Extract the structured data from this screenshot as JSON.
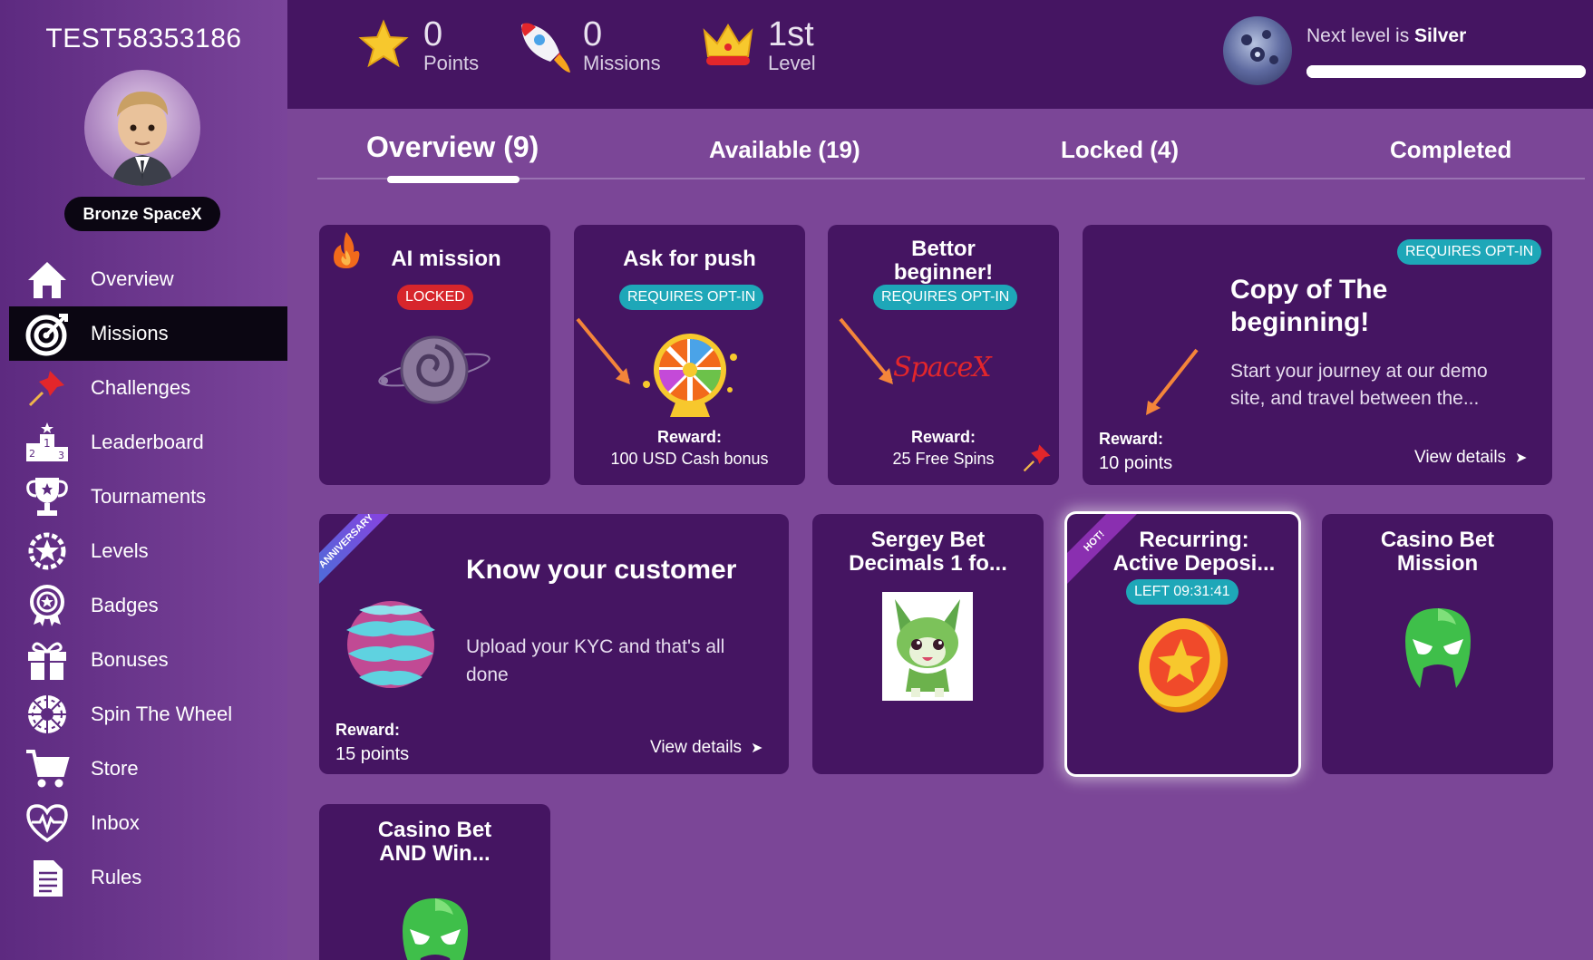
{
  "sidebar": {
    "username": "TEST58353186",
    "rank": "Bronze SpaceX",
    "items": [
      {
        "label": "Overview",
        "icon": "home-icon"
      },
      {
        "label": "Missions",
        "icon": "target-icon",
        "active": true
      },
      {
        "label": "Challenges",
        "icon": "pin-icon"
      },
      {
        "label": "Leaderboard",
        "icon": "podium-icon"
      },
      {
        "label": "Tournaments",
        "icon": "trophy-icon"
      },
      {
        "label": "Levels",
        "icon": "star-gear-icon"
      },
      {
        "label": "Badges",
        "icon": "badge-icon"
      },
      {
        "label": "Bonuses",
        "icon": "gift-icon"
      },
      {
        "label": "Spin The Wheel",
        "icon": "wheel-icon"
      },
      {
        "label": "Store",
        "icon": "cart-icon"
      },
      {
        "label": "Inbox",
        "icon": "heart-pulse-icon"
      },
      {
        "label": "Rules",
        "icon": "document-icon"
      }
    ]
  },
  "topbar": {
    "points": {
      "value": "0",
      "label": "Points"
    },
    "missions": {
      "value": "0",
      "label": "Missions"
    },
    "level": {
      "value": "1st",
      "label": "Level"
    },
    "next_level_prefix": "Next level is",
    "next_level_name": "Silver",
    "progress": 1.0
  },
  "tabs": [
    {
      "label": "Overview (9)",
      "active": true
    },
    {
      "label": "Available (19)"
    },
    {
      "label": "Locked (4)"
    },
    {
      "label": "Completed"
    }
  ],
  "cards": {
    "ai_mission": {
      "title": "AI mission",
      "status": "LOCKED"
    },
    "ask_push": {
      "title": "Ask for push",
      "status": "REQUIRES OPT-IN",
      "reward_label": "Reward:",
      "reward": "100 USD Cash bonus"
    },
    "bettor": {
      "title_line1": "Bettor",
      "title_line2": "beginner!",
      "status": "REQUIRES OPT-IN",
      "brand": "SpaceX",
      "reward_label": "Reward:",
      "reward": "25 Free Spins"
    },
    "copy": {
      "status": "REQUIRES OPT-IN",
      "title_line1": "Copy of The",
      "title_line2": "beginning!",
      "desc_line1": "Start your journey at our demo",
      "desc_line2": "site, and travel between the...",
      "reward_label": "Reward:",
      "reward": "10 points",
      "view": "View details"
    },
    "kyc": {
      "ribbon": "ANNIVERSARY",
      "title": "Know your customer",
      "desc_line1": "Upload your KYC and that's all",
      "desc_line2": "done",
      "reward_label": "Reward:",
      "reward": "15 points",
      "view": "View details"
    },
    "sergey": {
      "title_line1": "Sergey Bet",
      "title_line2": "Decimals 1 fo..."
    },
    "recurring": {
      "ribbon": "HOT!",
      "title_line1": "Recurring:",
      "title_line2": "Active Deposi...",
      "timer": "LEFT 09:31:41"
    },
    "casino_mission": {
      "title_line1": "Casino Bet",
      "title_line2": "Mission"
    },
    "casino_win": {
      "title_line1": "Casino Bet",
      "title_line2": "AND Win..."
    }
  },
  "colors": {
    "sidebar": "#5d2a80",
    "topbar": "#451562",
    "card": "#451562",
    "background": "#7b4697",
    "locked": "#d7262c",
    "optin": "#1ea7b8",
    "active_nav": "#0b0612"
  }
}
